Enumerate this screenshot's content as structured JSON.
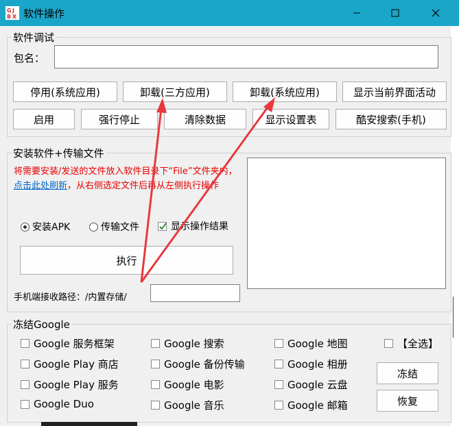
{
  "window": {
    "title": "软件操作",
    "icon": "app-icon",
    "controls": [
      "minimize-icon",
      "maximize-icon",
      "close-icon"
    ]
  },
  "debug": {
    "legend": "软件调试",
    "package_label": "包名：",
    "package_value": "",
    "buttons_row1": [
      "停用(系统应用)",
      "卸载(三方应用)",
      "卸载(系统应用)",
      "显示当前界面活动"
    ],
    "buttons_row2": [
      "启用",
      "强行停止",
      "清除数据",
      "显示设置表",
      "酷安搜索(手机)"
    ]
  },
  "install": {
    "legend": "安装软件+传输文件",
    "instruction_part1": "将需要安装/发送的文件放入软件目录下“File”文件夹内，",
    "instruction_link": "点击此处刷新",
    "instruction_part2": "，从右侧选定文件后再从左侧执行操作",
    "radio_apk": "安装APK",
    "radio_transfer": "传输文件",
    "radio_selected": "安装APK",
    "checkbox_show_result": "显示操作结果",
    "checkbox_show_result_checked": true,
    "execute_button": "执行",
    "path_label": "手机端接收路径：/内置存储/",
    "path_value": ""
  },
  "freeze": {
    "legend": "冻结Google",
    "items": [
      [
        "Google 服务框架",
        "Google 搜索",
        "Google 地图"
      ],
      [
        "Google Play 商店",
        "Google 备份传输",
        "Google 相册"
      ],
      [
        "Google Play 服务",
        "Google 电影",
        "Google 云盘"
      ],
      [
        "Google Duo",
        "Google 音乐",
        "Google 邮箱"
      ]
    ],
    "select_all": "【全选】",
    "freeze_button": "冻结",
    "restore_button": "恢复"
  },
  "colors": {
    "titlebar": "#1aa6c9",
    "annotation_arrow": "#e8383d",
    "instruction_text": "#e60000",
    "link": "#0066cc"
  }
}
